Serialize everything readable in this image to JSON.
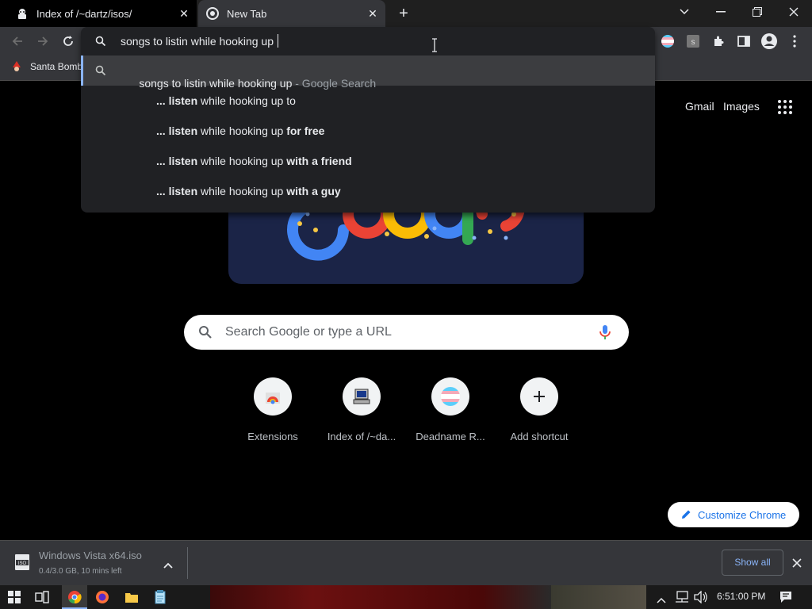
{
  "tabs": [
    {
      "title": "Index of /~dartz/isos/",
      "icon": "page-icon"
    },
    {
      "title": "New Tab",
      "icon": "chrome-icon"
    }
  ],
  "omnibox": {
    "value": "songs to listin while hooking up ",
    "first_suggestion": {
      "text": "songs to listin while hooking up",
      "suffix": " - Google Search"
    },
    "suggestions": [
      {
        "prefix": "... ",
        "bold1": "listen",
        "mid": " while hooking up",
        "bold2": "",
        "tail": " to"
      },
      {
        "prefix": "... ",
        "bold1": "listen",
        "mid": " while hooking up ",
        "bold2": "for free",
        "tail": ""
      },
      {
        "prefix": "... ",
        "bold1": "listen",
        "mid": " while hooking up ",
        "bold2": "with a friend",
        "tail": ""
      },
      {
        "prefix": "... ",
        "bold1": "listen",
        "mid": " while hooking up ",
        "bold2": "with a guy",
        "tail": ""
      }
    ]
  },
  "bookmarks": [
    {
      "label": "Santa Bomb"
    }
  ],
  "header_links": {
    "gmail": "Gmail",
    "images": "Images"
  },
  "search": {
    "placeholder": "Search Google or type a URL"
  },
  "shortcuts": [
    {
      "label": "Extensions",
      "icon": "chrome-web-store-icon"
    },
    {
      "label": "Index of /~da...",
      "icon": "computer-icon"
    },
    {
      "label": "Deadname R...",
      "icon": "trans-flag-icon"
    },
    {
      "label": "Add shortcut",
      "icon": "plus-icon"
    }
  ],
  "customize_label": "Customize Chrome",
  "download": {
    "filename": "Windows Vista x64.iso",
    "status": "0.4/3.0 GB, 10 mins left",
    "icon_text": "ISO",
    "show_all": "Show all"
  },
  "taskbar": {
    "time": "6:51:00 PM"
  },
  "colors": {
    "accent": "#8ab4f8",
    "link": "#1a73e8",
    "toolbar": "#35363a"
  }
}
